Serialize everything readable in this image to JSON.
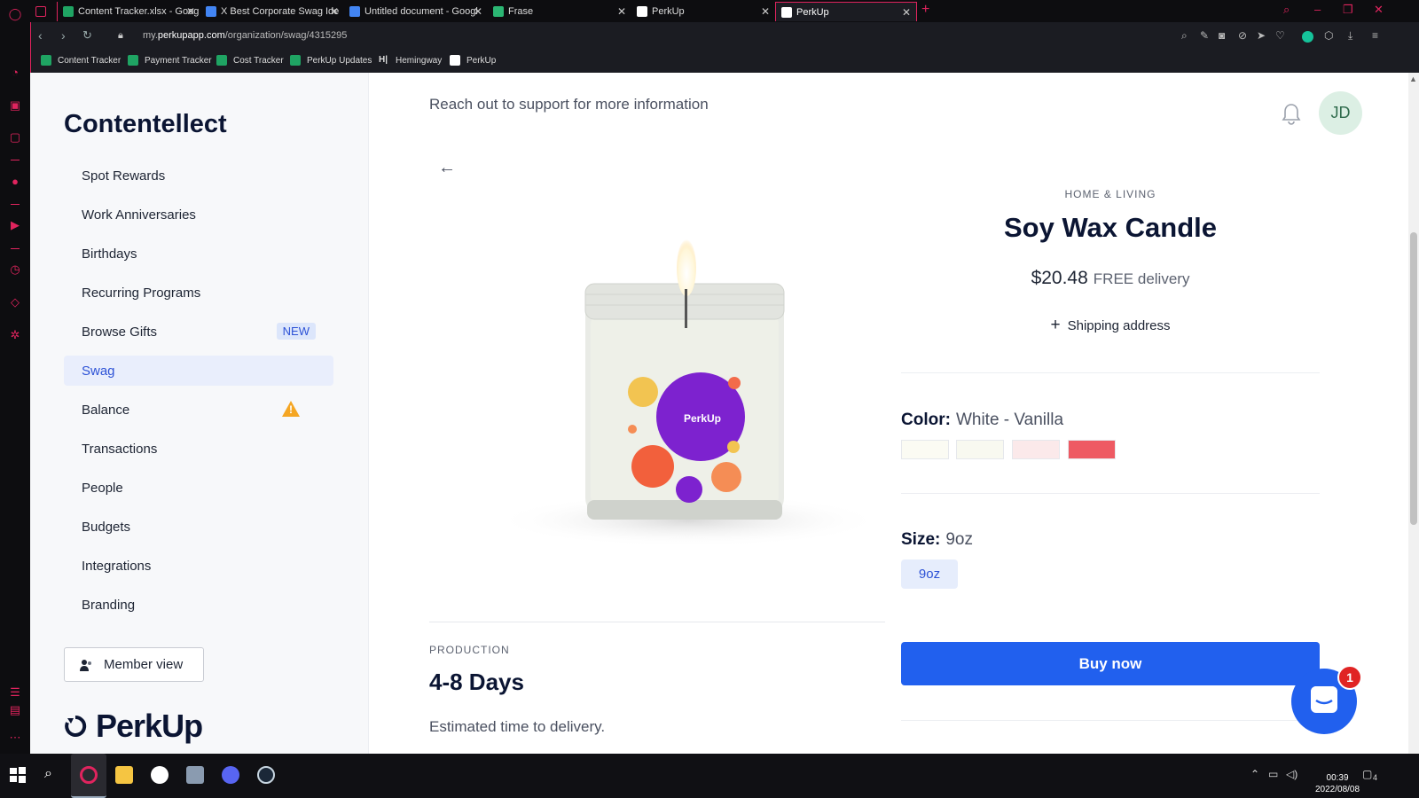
{
  "browser": {
    "tabs": [
      {
        "title": "Content Tracker.xlsx - Goog",
        "fav_color": "#1fa463"
      },
      {
        "title": "X Best Corporate Swag Ide",
        "fav_color": "#4285f4"
      },
      {
        "title": "Untitled document - Googl",
        "fav_color": "#4285f4"
      },
      {
        "title": "Frase",
        "fav_color": "#2bb673"
      },
      {
        "title": "PerkUp",
        "fav_color": "#ffffff"
      },
      {
        "title": "PerkUp",
        "fav_color": "#ffffff"
      }
    ],
    "url_prefix": "my.",
    "url_domain": "perkupapp.com",
    "url_path": "/organization/swag/4315295",
    "bookmarks": [
      {
        "label": "Content Tracker",
        "fav_color": "#1fa463"
      },
      {
        "label": "Payment Tracker",
        "fav_color": "#1fa463"
      },
      {
        "label": "Cost Tracker",
        "fav_color": "#1fa463"
      },
      {
        "label": "PerkUp Updates",
        "fav_color": "#1fa463"
      },
      {
        "label": "Hemingway",
        "fav_color": "#dddddd"
      },
      {
        "label": "PerkUp",
        "fav_color": "#ffffff"
      }
    ]
  },
  "sidebar": {
    "org_name": "Contentellect",
    "items": [
      {
        "label": "Spot Rewards"
      },
      {
        "label": "Work Anniversaries"
      },
      {
        "label": "Birthdays"
      },
      {
        "label": "Recurring Programs"
      },
      {
        "label": "Browse Gifts",
        "badge": "NEW"
      },
      {
        "label": "Swag",
        "selected": true
      },
      {
        "label": "Balance",
        "warning": true
      },
      {
        "label": "Transactions"
      },
      {
        "label": "People"
      },
      {
        "label": "Budgets"
      },
      {
        "label": "Integrations"
      },
      {
        "label": "Branding"
      }
    ],
    "member_view_label": "Member view",
    "logo_text": "PerkUp"
  },
  "header": {
    "support_text": "Reach out to support for more information",
    "avatar_initials": "JD"
  },
  "product": {
    "category": "HOME & LIVING",
    "title": "Soy Wax Candle",
    "price": "$20.48",
    "delivery": "FREE delivery",
    "shipping_label": "Shipping address",
    "color_label": "Color:",
    "color_value": "White - Vanilla",
    "swatches": [
      "#fbfbf3",
      "#f8f9f0",
      "#fbe9ea",
      "#ee5a63"
    ],
    "size_label": "Size:",
    "size_value": "9oz",
    "size_options": [
      "9oz"
    ],
    "buy_label": "Buy now",
    "candle_label": "PerkUp",
    "production_label": "PRODUCTION",
    "production_days": "4-8 Days",
    "production_desc": "Estimated time to delivery."
  },
  "chat": {
    "badge_count": "1"
  },
  "taskbar": {
    "time": "00:39",
    "date": "2022/08/08",
    "notif_count": "4"
  },
  "colors": {
    "accent": "#2160ee",
    "opera_red": "#e0245e",
    "warning": "#f5a623"
  }
}
